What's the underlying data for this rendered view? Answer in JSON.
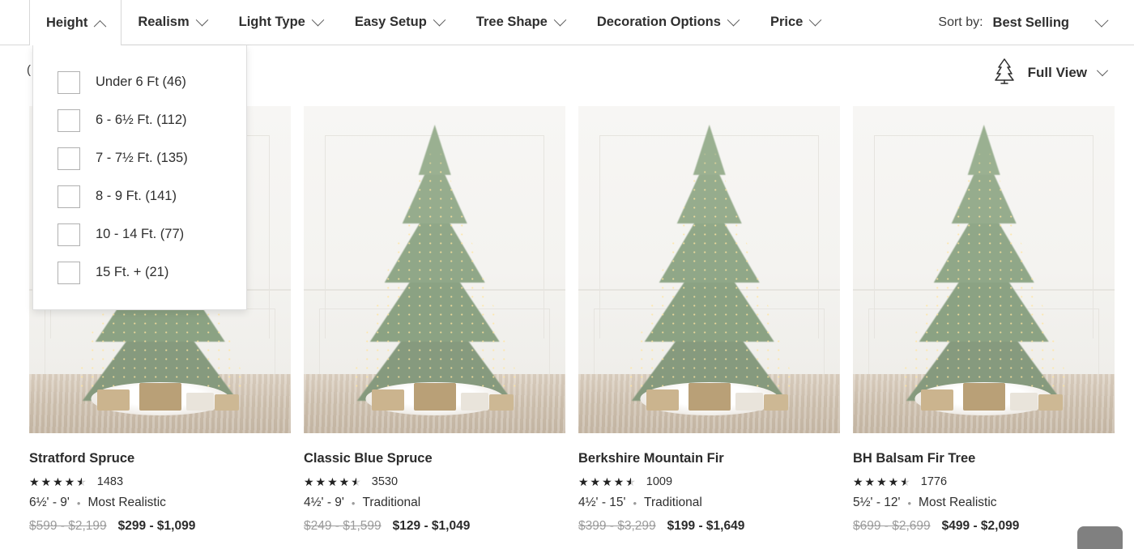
{
  "filter_bar": {
    "filters": [
      {
        "label": "Height",
        "state": "open",
        "chevron": "chevron-up-icon"
      },
      {
        "label": "Realism",
        "state": "closed",
        "chevron": "chevron-down-icon"
      },
      {
        "label": "Light Type",
        "state": "closed",
        "chevron": "chevron-down-icon"
      },
      {
        "label": "Easy Setup",
        "state": "closed",
        "chevron": "chevron-down-icon"
      },
      {
        "label": "Tree Shape",
        "state": "closed",
        "chevron": "chevron-down-icon"
      },
      {
        "label": "Decoration Options",
        "state": "closed",
        "chevron": "chevron-down-icon"
      },
      {
        "label": "Price",
        "state": "closed",
        "chevron": "chevron-down-icon"
      }
    ],
    "sort": {
      "label": "Sort by:",
      "value": "Best Selling",
      "chevron": "chevron-down-icon"
    }
  },
  "subbar": {
    "result_count_partial": "(",
    "full_view": {
      "label": "Full View",
      "icon": "christmas-tree-icon",
      "chevron": "chevron-down-icon"
    }
  },
  "height_dropdown": {
    "open": true,
    "options": [
      {
        "label": "Under 6 Ft (46)",
        "checked": false
      },
      {
        "label": "6 - 6½ Ft. (112)",
        "checked": false
      },
      {
        "label": "7 - 7½ Ft. (135)",
        "checked": false
      },
      {
        "label": "8 - 9 Ft. (141)",
        "checked": false
      },
      {
        "label": "10 - 14 Ft. (77)",
        "checked": false
      },
      {
        "label": "15 Ft. + (21)",
        "checked": false
      }
    ]
  },
  "products": [
    {
      "title": "Stratford Spruce",
      "rating": 4.5,
      "review_count": "1483",
      "size_range": "6½' - 9'",
      "realism": "Most Realistic",
      "price_was": "$599 - $2,199",
      "price_now": "$299 - $1,099",
      "image_alt": "stratford-spruce-tree-photo"
    },
    {
      "title": "Classic Blue Spruce",
      "rating": 4.5,
      "review_count": "3530",
      "size_range": "4½' - 9'",
      "realism": "Traditional",
      "price_was": "$249 - $1,599",
      "price_now": "$129 - $1,049",
      "image_alt": "classic-blue-spruce-tree-photo"
    },
    {
      "title": "Berkshire Mountain Fir",
      "rating": 4.5,
      "review_count": "1009",
      "size_range": "4½' - 15'",
      "realism": "Traditional",
      "price_was": "$399 - $3,299",
      "price_now": "$199 - $1,649",
      "image_alt": "berkshire-mountain-fir-tree-photo"
    },
    {
      "title": "BH Balsam Fir Tree",
      "rating": 4.5,
      "review_count": "1776",
      "size_range": "5½' - 12'",
      "realism": "Most Realistic",
      "price_was": "$699 - $2,699",
      "price_now": "$499 - $2,099",
      "image_alt": "bh-balsam-fir-tree-photo"
    }
  ],
  "chat_widget": {
    "name": "chat-support-button"
  },
  "colors": {
    "text_primary": "#2b2b2b",
    "text_muted": "#9b9b9b",
    "border": "#d8d8d8",
    "tree_green": "#7f9078",
    "light_gold": "#ffe5a0"
  }
}
